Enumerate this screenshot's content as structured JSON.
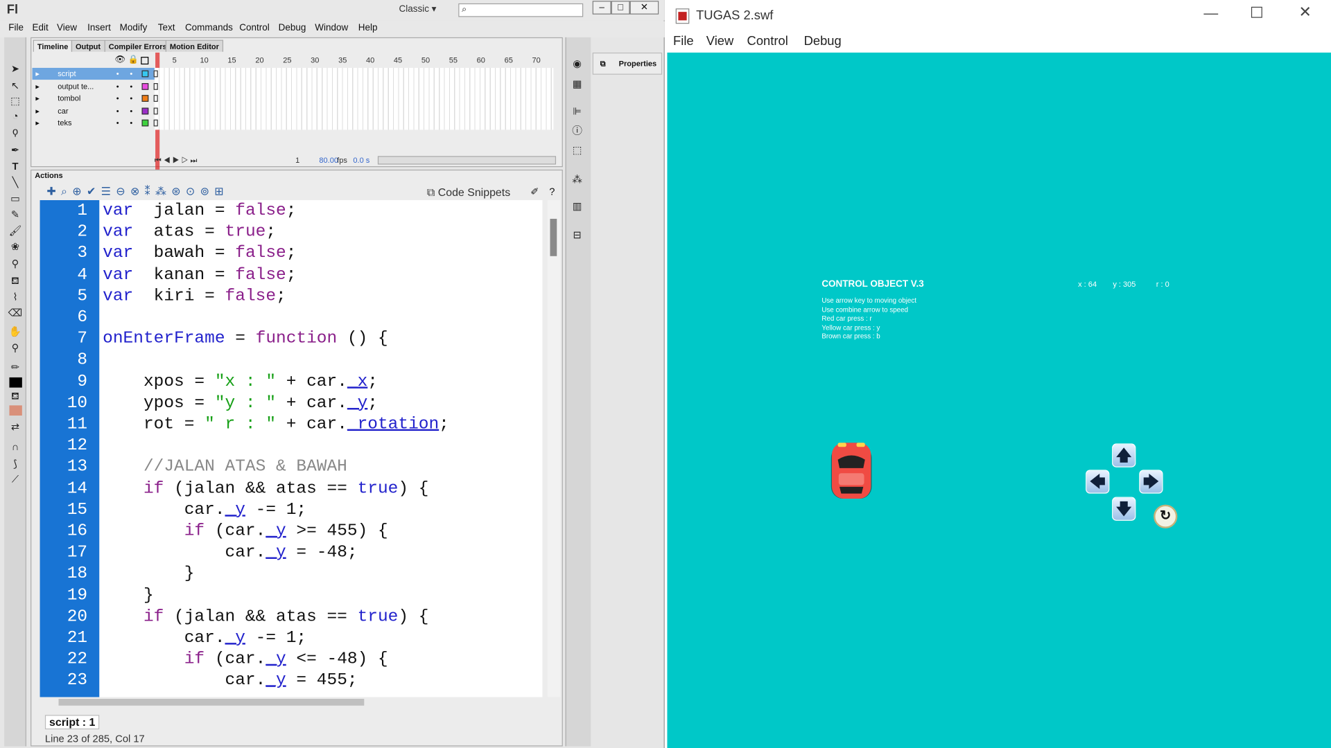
{
  "flash": {
    "logo": "Fl",
    "workspace": "Classic",
    "menu": [
      "File",
      "Edit",
      "View",
      "Insert",
      "Modify",
      "Text",
      "Commands",
      "Control",
      "Debug",
      "Window",
      "Help"
    ],
    "timeline_tabs": [
      "Timeline",
      "Output",
      "Compiler Errors",
      "Motion Editor"
    ],
    "layers": [
      {
        "name": "script",
        "color": "#36c7f0"
      },
      {
        "name": "output te...",
        "color": "#e94de0"
      },
      {
        "name": "tombol",
        "color": "#f07d16"
      },
      {
        "name": "car",
        "color": "#9b2ec7"
      },
      {
        "name": "teks",
        "color": "#3ed13e"
      }
    ],
    "frame_numbers": [
      "5",
      "10",
      "15",
      "20",
      "25",
      "30",
      "35",
      "40",
      "45",
      "50",
      "55",
      "60",
      "65",
      "70"
    ],
    "frame_current": "1",
    "fps": "80.00",
    "fps_unit": "fps",
    "time": "0.0 s",
    "actions_title": "Actions",
    "code_snippets": "Code Snippets",
    "properties": "Properties",
    "script_tab": "script : 1",
    "status_line": "Line 23 of 285, Col 17"
  },
  "code_lines": [
    {
      "n": "1",
      "t": [
        [
          "kw",
          "var"
        ],
        [
          "",
          "  jalan = "
        ],
        [
          "kw2",
          "false"
        ],
        [
          "",
          ";"
        ]
      ]
    },
    {
      "n": "2",
      "t": [
        [
          "kw",
          "var"
        ],
        [
          "",
          "  atas = "
        ],
        [
          "kw2",
          "true"
        ],
        [
          "",
          ";"
        ]
      ]
    },
    {
      "n": "3",
      "t": [
        [
          "kw",
          "var"
        ],
        [
          "",
          "  bawah = "
        ],
        [
          "kw2",
          "false"
        ],
        [
          "",
          ";"
        ]
      ]
    },
    {
      "n": "4",
      "t": [
        [
          "kw",
          "var"
        ],
        [
          "",
          "  kanan = "
        ],
        [
          "kw2",
          "false"
        ],
        [
          "",
          ";"
        ]
      ]
    },
    {
      "n": "5",
      "t": [
        [
          "kw",
          "var"
        ],
        [
          "",
          "  kiri = "
        ],
        [
          "kw2",
          "false"
        ],
        [
          "",
          ";"
        ]
      ]
    },
    {
      "n": "6",
      "t": []
    },
    {
      "n": "7",
      "t": [
        [
          "kw",
          "onEnterFrame"
        ],
        [
          "",
          " = "
        ],
        [
          "kw2",
          "function"
        ],
        [
          "",
          " () {"
        ]
      ]
    },
    {
      "n": "8",
      "t": []
    },
    {
      "n": "9",
      "t": [
        [
          "",
          "    xpos = "
        ],
        [
          "str",
          "\"x : \""
        ],
        [
          "",
          " + car."
        ],
        [
          "prop",
          "_x"
        ],
        [
          "",
          ";"
        ]
      ]
    },
    {
      "n": "10",
      "t": [
        [
          "",
          "    ypos = "
        ],
        [
          "str",
          "\"y : \""
        ],
        [
          "",
          " + car."
        ],
        [
          "prop",
          "_y"
        ],
        [
          "",
          ";"
        ]
      ]
    },
    {
      "n": "11",
      "t": [
        [
          "",
          "    rot = "
        ],
        [
          "str",
          "\" r : \""
        ],
        [
          "",
          " + car."
        ],
        [
          "prop",
          "_rotation"
        ],
        [
          "",
          ";"
        ]
      ]
    },
    {
      "n": "12",
      "t": []
    },
    {
      "n": "13",
      "t": [
        [
          "cmt",
          "    //JALAN ATAS & BAWAH"
        ]
      ]
    },
    {
      "n": "14",
      "t": [
        [
          "kw2",
          "    if"
        ],
        [
          "",
          " (jalan && atas == "
        ],
        [
          "kw",
          "true"
        ],
        [
          "",
          ") {"
        ]
      ]
    },
    {
      "n": "15",
      "t": [
        [
          "",
          "        car."
        ],
        [
          "prop",
          "_y"
        ],
        [
          "",
          " -= 1;"
        ]
      ]
    },
    {
      "n": "16",
      "t": [
        [
          "kw2",
          "        if"
        ],
        [
          "",
          " (car."
        ],
        [
          "prop",
          "_y"
        ],
        [
          "",
          " >= 455) {"
        ]
      ]
    },
    {
      "n": "17",
      "t": [
        [
          "",
          "            car."
        ],
        [
          "prop",
          "_y"
        ],
        [
          "",
          " = -48;"
        ]
      ]
    },
    {
      "n": "18",
      "t": [
        [
          "",
          "        }"
        ]
      ]
    },
    {
      "n": "19",
      "t": [
        [
          "",
          "    }"
        ]
      ]
    },
    {
      "n": "20",
      "t": [
        [
          "kw2",
          "    if"
        ],
        [
          "",
          " (jalan && atas == "
        ],
        [
          "kw",
          "true"
        ],
        [
          "",
          ") {"
        ]
      ]
    },
    {
      "n": "21",
      "t": [
        [
          "",
          "        car."
        ],
        [
          "prop",
          "_y"
        ],
        [
          "",
          " -= 1;"
        ]
      ]
    },
    {
      "n": "22",
      "t": [
        [
          "kw2",
          "        if"
        ],
        [
          "",
          " (car."
        ],
        [
          "prop",
          "_y"
        ],
        [
          "",
          " <= -48) {"
        ]
      ]
    },
    {
      "n": "23",
      "t": [
        [
          "",
          "            car."
        ],
        [
          "prop",
          "_y"
        ],
        [
          "",
          " = 455;"
        ]
      ]
    }
  ],
  "player": {
    "title": "TUGAS 2.swf",
    "menu": [
      "File",
      "View",
      "Control",
      "Debug"
    ],
    "bg_color": "#00c8c8",
    "heading": "CONTROL OBJECT V.3",
    "instructions": [
      "Use arrow key to moving object",
      "Use combine arrow to speed",
      "Red car press : r",
      "Yellow car press : y",
      "Brown car press : b"
    ],
    "x_readout": "x : 64",
    "y_readout": "y : 305",
    "r_readout": "r : 0",
    "buttons": {
      "up": "🡅",
      "left": "🡄",
      "right": "🡆",
      "down": "🡇",
      "reset": "↻"
    }
  }
}
